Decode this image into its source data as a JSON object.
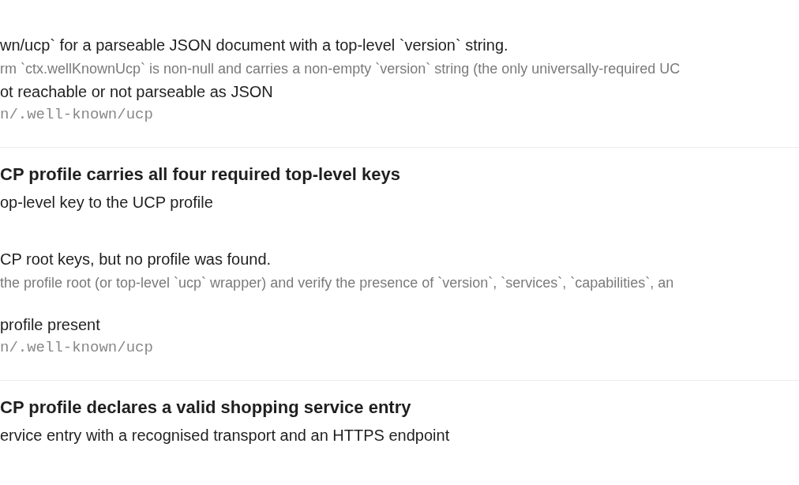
{
  "sections": [
    {
      "blocks": [
        [
          {
            "kind": "text",
            "text": "wn/ucp` for a parseable JSON document with a top-level `version` string."
          },
          {
            "kind": "note",
            "text": "rm `ctx.wellKnownUcp` is non-null and carries a non-empty `version` string (the only universally-required UC"
          },
          {
            "kind": "text",
            "text": "ot reachable or not parseable as JSON"
          },
          {
            "kind": "code",
            "text": "n/.well-known/ucp"
          }
        ]
      ]
    },
    {
      "blocks": [
        [
          {
            "kind": "title",
            "text": "CP profile carries all four required top-level keys"
          },
          {
            "kind": "subtitle",
            "text": "op-level key to the UCP profile"
          }
        ],
        [
          {
            "kind": "text",
            "text": "CP root keys, but no profile was found."
          },
          {
            "kind": "note",
            "text": "the profile root (or top-level `ucp` wrapper) and verify the presence of `version`, `services`, `capabilities`, an"
          }
        ],
        [
          {
            "kind": "text",
            "text": "profile present"
          },
          {
            "kind": "code",
            "text": "n/.well-known/ucp"
          }
        ]
      ]
    },
    {
      "blocks": [
        [
          {
            "kind": "title",
            "text": "CP profile declares a valid shopping service entry"
          },
          {
            "kind": "subtitle",
            "text": "ervice entry with a recognised transport and an HTTPS endpoint"
          }
        ]
      ]
    }
  ]
}
